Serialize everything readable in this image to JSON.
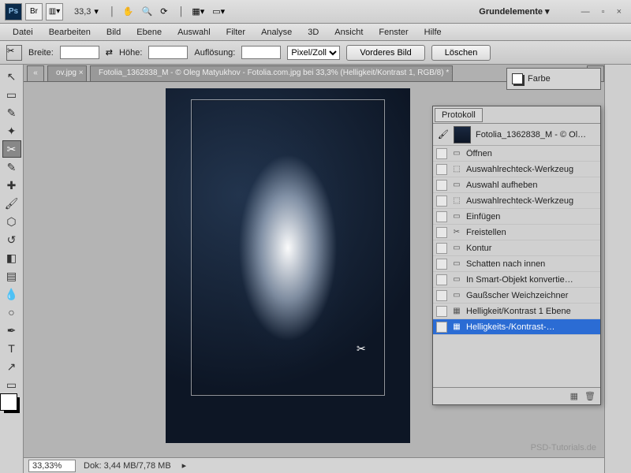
{
  "titlebar": {
    "zoom": "33,3",
    "workspace": "Grundelemente ▾"
  },
  "menu": [
    "Datei",
    "Bearbeiten",
    "Bild",
    "Ebene",
    "Auswahl",
    "Filter",
    "Analyse",
    "3D",
    "Ansicht",
    "Fenster",
    "Hilfe"
  ],
  "optbar": {
    "breite": "Breite:",
    "hoehe": "Höhe:",
    "aufl": "Auflösung:",
    "unit": "Pixel/Zoll",
    "btn1": "Vorderes Bild",
    "btn2": "Löschen"
  },
  "tabs": {
    "short": "ov.jpg ×",
    "main": "Fotolia_1362838_M - © Oleg Matyukhov - Fotolia.com.jpg bei 33,3% (Helligkeit/Kontrast 1, RGB/8) * ×"
  },
  "status": {
    "zoom": "33,33%",
    "dok": "Dok: 3,44 MB/7,78 MB"
  },
  "farbe": {
    "label": "Farbe"
  },
  "history": {
    "title": "Protokoll",
    "doc": "Fotolia_1362838_M - © Ol…",
    "items": [
      {
        "icon": "▭",
        "label": "Öffnen"
      },
      {
        "icon": "⬚",
        "label": "Auswahlrechteck-Werkzeug"
      },
      {
        "icon": "▭",
        "label": "Auswahl aufheben"
      },
      {
        "icon": "⬚",
        "label": "Auswahlrechteck-Werkzeug"
      },
      {
        "icon": "▭",
        "label": "Einfügen"
      },
      {
        "icon": "✂",
        "label": "Freistellen"
      },
      {
        "icon": "▭",
        "label": "Kontur"
      },
      {
        "icon": "▭",
        "label": "Schatten nach innen"
      },
      {
        "icon": "▭",
        "label": "In Smart-Objekt konvertie…"
      },
      {
        "icon": "▭",
        "label": "Gaußscher Weichzeichner"
      },
      {
        "icon": "▦",
        "label": "Helligkeit/Kontrast 1 Ebene"
      },
      {
        "icon": "▦",
        "label": "Helligkeits-/Kontrast-…",
        "sel": true
      }
    ]
  },
  "watermark": "PSD-Tutorials.de"
}
